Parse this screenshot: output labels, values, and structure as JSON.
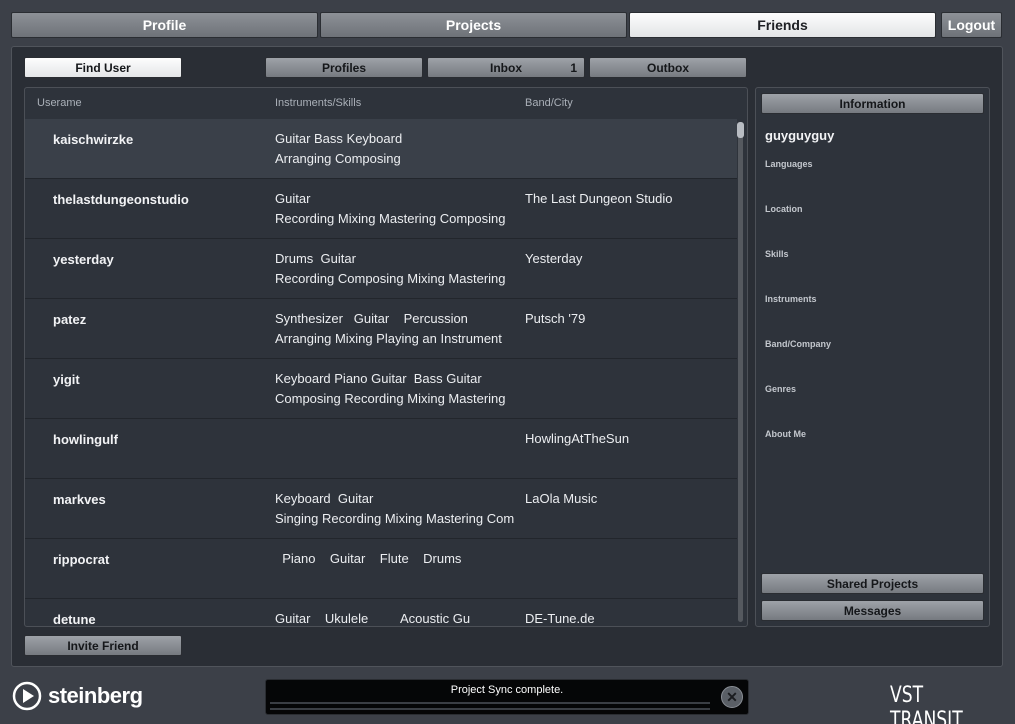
{
  "top_tabs": [
    "Profile",
    "Projects",
    "Friends"
  ],
  "logout_label": "Logout",
  "toolbar": {
    "find_user": "Find User",
    "profiles": "Profiles",
    "inbox": "Inbox",
    "inbox_count": "1",
    "outbox": "Outbox"
  },
  "list": {
    "headers": [
      "Userame",
      "Instruments/Skills",
      "Band/City"
    ],
    "rows": [
      {
        "user": "kaischwirzke",
        "instr1": "Guitar Bass Keyboard",
        "instr2": "Arranging Composing",
        "band": ""
      },
      {
        "user": "thelastdungeonstudio",
        "instr1": "Guitar",
        "instr2": "Recording Mixing Mastering Composing",
        "band": "The Last Dungeon Studio"
      },
      {
        "user": "yesterday",
        "instr1": "Drums  Guitar",
        "instr2": "Recording Composing Mixing Mastering",
        "band": "Yesterday"
      },
      {
        "user": "patez",
        "instr1": "Synthesizer   Guitar    Percussion",
        "instr2": "Arranging Mixing Playing an Instrument",
        "band": "Putsch '79"
      },
      {
        "user": "yigit",
        "instr1": "Keyboard Piano Guitar  Bass Guitar",
        "instr2": "Composing Recording Mixing Mastering",
        "band": ""
      },
      {
        "user": "howlingulf",
        "instr1": "",
        "instr2": "",
        "band": "HowlingAtTheSun"
      },
      {
        "user": "markves",
        "instr1": "Keyboard  Guitar",
        "instr2": "Singing Recording Mixing Mastering Com",
        "band": "LaOla Music"
      },
      {
        "user": "rippocrat",
        "instr1": "  Piano    Guitar    Flute    Drums",
        "instr2": "",
        "band": ""
      },
      {
        "user": "detune",
        "instr1": "Guitar    Ukulele         Acoustic Gu",
        "instr2": "",
        "band": "DE-Tune.de"
      }
    ]
  },
  "invite_friend": "Invite Friend",
  "info": {
    "tab_label": "Information",
    "username": "guyguyguy",
    "labels": [
      "Languages",
      "Location",
      "Skills",
      "Instruments",
      "Band/Company",
      "Genres",
      "About Me"
    ],
    "shared_projects": "Shared Projects",
    "messages": "Messages"
  },
  "footer": {
    "logo_text": "steinberg",
    "status": "Project Sync complete.",
    "close_glyph": "✕",
    "brand": "VST TRANSIT"
  }
}
